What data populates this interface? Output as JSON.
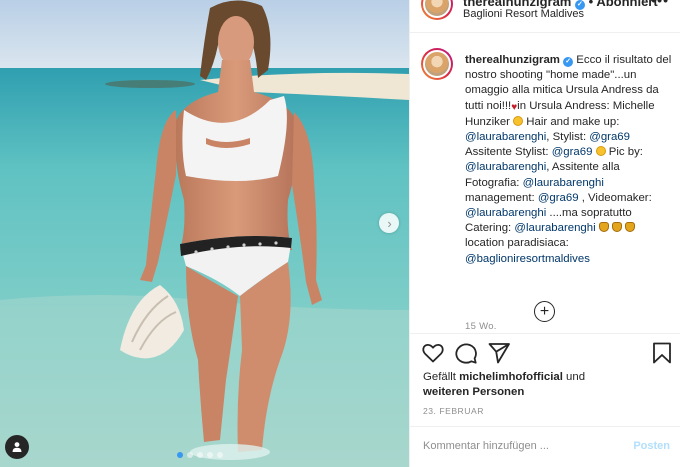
{
  "post": {
    "username": "therealhunzigram",
    "follow_label": "Abonniert",
    "separator": "•",
    "location": "Baglioni Resort Maldives",
    "more": "•••"
  },
  "caption": {
    "username": "therealhunzigram",
    "t1": " Ecco il risultato del nostro shooting \"home made\"...un omaggio alla mitica Ursula Andress da tutti noi!!!",
    "t2": "in Ursula Andress: Michelle Hunziker ",
    "t3": " Hair and make up: ",
    "m1": "@laurabarenghi",
    "t4": ", Stylist: ",
    "m2": "@gra69",
    "t5": " Assitente Stylist: ",
    "m3": "@gra69",
    "t6": " Pic by: ",
    "m4": "@laurabarenghi",
    "t7": ", Assitente alla Fotografia: ",
    "m5": "@laurabarenghi",
    "t8": " management: ",
    "m6": "@gra69",
    "t9": " , Videomaker: ",
    "m7": "@laurabarenghi",
    "t10": " ....ma sopratutto Catering: ",
    "m8": "@laurabarenghi",
    "t11": " location paradisiaca: ",
    "m9": "@baglioniresortmaldives",
    "time_ago": "15 Wo."
  },
  "actions": {
    "like_icon": "heart-icon",
    "comment_icon": "comment-icon",
    "share_icon": "paper-plane-icon",
    "save_icon": "bookmark-icon"
  },
  "likes": {
    "prefix": "Gefällt ",
    "user": "michelimhofofficial",
    "middle": " und",
    "others": "weiteren Personen"
  },
  "date": "23. FEBRUAR",
  "comment": {
    "placeholder": "Kommentar hinzufügen ...",
    "post_label": "Posten"
  },
  "carousel": {
    "slides": 5,
    "active_index": 0
  },
  "colors": {
    "accent": "#3897f0",
    "mention": "#00376b",
    "muted": "#8e8e8e",
    "post_disabled": "#b2dffc"
  }
}
